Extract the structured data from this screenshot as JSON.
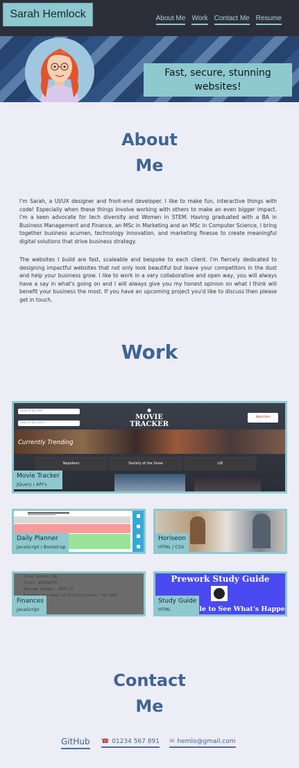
{
  "header": {
    "logo": "Sarah Hemlock",
    "nav": [
      "About Me",
      "Work",
      "Contact Me",
      "Resume"
    ]
  },
  "hero": {
    "tagline": "Fast, secure, stunning websites!"
  },
  "about": {
    "title_line1": "About",
    "title_line2": "Me",
    "p1": "I'm Sarah, a UI/UX designer and front-end developer. I like to make fun, interactive things with code! Especially when these things involve working with others to make an even bigger impact. I'm a keen advocate for tech diversity and Women in STEM. Having graduated with a BA in Business Management and Finance, an MSc in Marketing and an MSc in Computer Science, I bring together business acumen, technology innovation, and marketing finesse to create meaningful digital solutions that drive business strategy.",
    "p2": "The websites I build are fast, scaleable and bespoke to each client. I'm fiercely dedicated to designing impactful websites that not only look beautiful but leave your competitors in the dust and help your business grow. I like to work in a very collaborative and open way, you will always have a say in what's going on and I will always give you my honest opinion on what I think will benefit your business the most. If you have an upcoming project you'd like to discuss then please get in touch."
  },
  "work": {
    "title": "Work",
    "projects": [
      {
        "name": "Movie Tracker",
        "tech": "JQuery / API's",
        "screen": {
          "search1": "Search by title",
          "search2": "Search by actor",
          "brand_line1": "MOVIE",
          "brand_line2": "TRACKER",
          "watchlist": "Watchlist",
          "trending": "Currently Trending",
          "films": [
            "Napoleon",
            "Society of the Snow",
            "Lift"
          ]
        }
      },
      {
        "name": "Daily Planner",
        "tech": "JavaScript / Bootstrap"
      },
      {
        "name": "Horiseon",
        "tech": "HTML / CSS"
      },
      {
        "name": "Finances",
        "tech": "JavaScript",
        "screen": {
          "line1": "Total months: 86",
          "line2": "Total: $38382578",
          "line3": "Average change: -8075.21",
          "line4": "Greatest Increase in Profits/Losses: Feb-2012"
        }
      },
      {
        "name": "Study Guide",
        "tech": "HTML",
        "screen": {
          "heading": "Prework Study Guide",
          "footer": "Open the Console to See What's Happening"
        }
      }
    ]
  },
  "contact": {
    "title_line1": "Contact",
    "title_line2": "Me",
    "github": "GitHub",
    "phone": "01234 567 891",
    "email": "hemlo@gmail.com"
  },
  "colors": {
    "accent": "#8dc9ce",
    "heading": "#3f6494",
    "nav_bg": "#2c2f3a",
    "page_bg": "#ecedf5"
  }
}
